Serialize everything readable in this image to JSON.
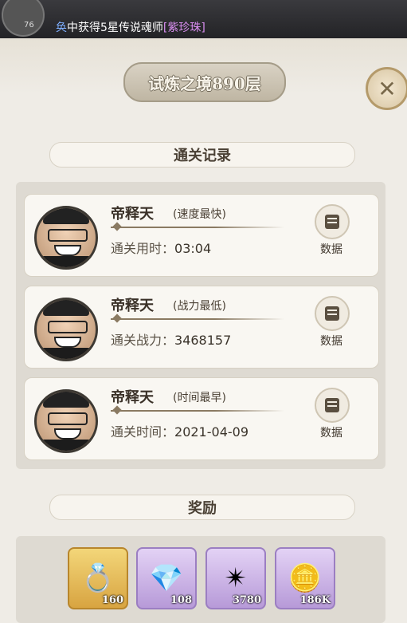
{
  "ticker": {
    "prefix": "奂",
    "text": "中获得5星传说魂师",
    "highlight": "[紫珍珠]",
    "level": "76"
  },
  "header": {
    "title": "试炼之境890层"
  },
  "sections": {
    "records_title": "通关记录",
    "rewards_title": "奖励"
  },
  "records": [
    {
      "name": "帝释天",
      "tag": "(速度最快)",
      "stat_label": "通关用时：",
      "stat_value": "03:04",
      "button_label": "数据"
    },
    {
      "name": "帝释天",
      "tag": "(战力最低)",
      "stat_label": "通关战力：",
      "stat_value": "3468157",
      "button_label": "数据"
    },
    {
      "name": "帝释天",
      "tag": "(时间最早)",
      "stat_label": "通关时间：",
      "stat_value": "2021-04-09",
      "button_label": "数据"
    }
  ],
  "rewards": [
    {
      "icon": "ring-icon",
      "count": "160",
      "rarity": "gold"
    },
    {
      "icon": "green-gem-icon",
      "count": "108",
      "rarity": "purple"
    },
    {
      "icon": "red-compass-icon",
      "count": "3780",
      "rarity": "purple"
    },
    {
      "icon": "coin-icon",
      "count": "186K",
      "rarity": "purple"
    }
  ]
}
